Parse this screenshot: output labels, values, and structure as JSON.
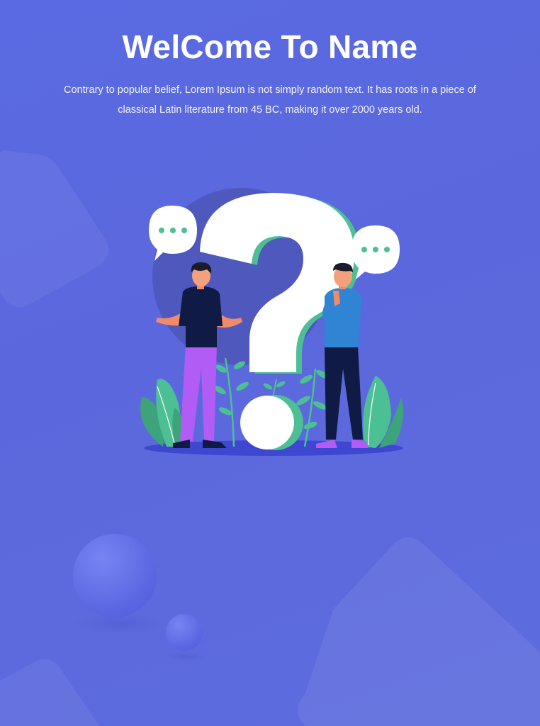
{
  "hero": {
    "title": "WelCome To Name",
    "subtitle": "Contrary to popular belief, Lorem Ipsum is not simply random text. It has roots in a piece of classical Latin literature from 45 BC, making it over 2000 years old."
  },
  "illustration": {
    "description_icon": "question-mark-people-illustration"
  },
  "colors": {
    "background": "#5a6ae2",
    "accent_green": "#4cbf94",
    "shirt_dark": "#0f1a45",
    "shirt_blue": "#2f84d4",
    "pants_purple": "#b05cf5",
    "white": "#ffffff"
  }
}
